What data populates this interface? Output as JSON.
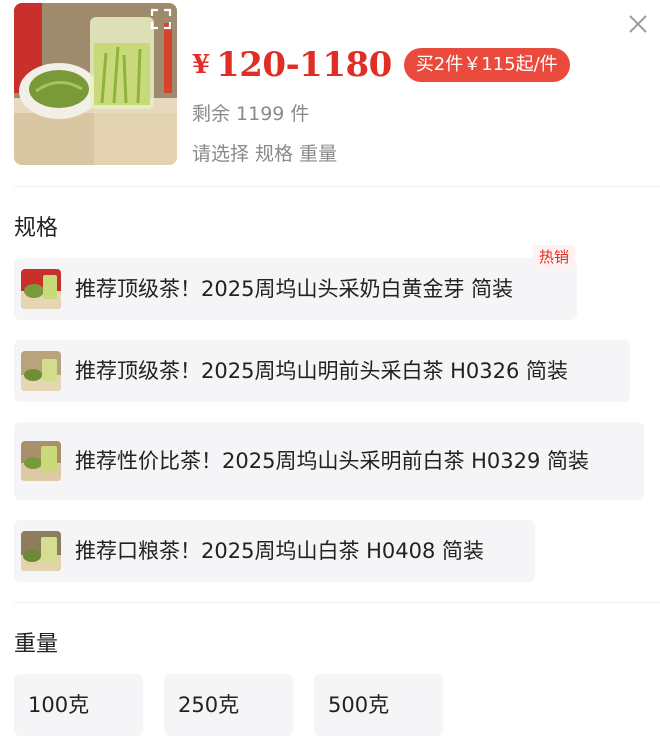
{
  "product": {
    "image_icon": "tea-glass-product-photo",
    "currency": "¥",
    "price_range": "120-1180",
    "promo": "买2件￥115起/件",
    "stock": "剩余 1199 件",
    "selection_hint": "请选择 规格 重量"
  },
  "specs": {
    "title": "规格",
    "hot_badge": "热销",
    "options": [
      {
        "label": "推荐顶级茶！2025周坞山头采奶白黄金芽 简装"
      },
      {
        "label": "推荐顶级茶！2025周坞山明前头采白茶 H0326 简装"
      },
      {
        "label": "推荐性价比茶！2025周坞山头采明前白茶 H0329 简装"
      },
      {
        "label": "推荐口粮茶！2025周坞山白茶 H0408 简装"
      }
    ]
  },
  "weights": {
    "title": "重量",
    "options": [
      "100克",
      "250克",
      "500克"
    ]
  },
  "colors": {
    "price": "#e02e24",
    "promo_bg": "#ea4a3c",
    "option_bg": "#f5f5f7",
    "muted_text": "#8a8a8a"
  }
}
